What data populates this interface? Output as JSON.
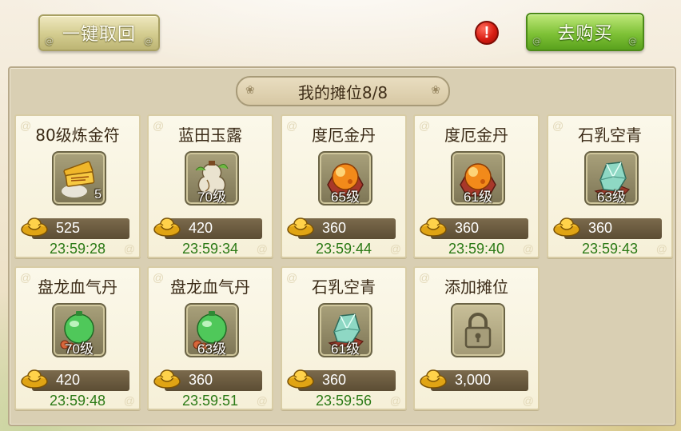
{
  "header": {
    "withdraw_all_label": "一键取回",
    "buy_label": "去购买",
    "alert_symbol": "!"
  },
  "panel": {
    "title": "我的摊位8/8"
  },
  "stalls": [
    {
      "name": "80级炼金符",
      "badge": "5",
      "price": "525",
      "timer": "23:59:28",
      "icon": "gold-talisman-icon"
    },
    {
      "name": "蓝田玉露",
      "badge": "70级",
      "price": "420",
      "timer": "23:59:34",
      "icon": "jade-gourd-icon"
    },
    {
      "name": "度厄金丹",
      "badge": "65级",
      "price": "360",
      "timer": "23:59:44",
      "icon": "golden-pill-icon"
    },
    {
      "name": "度厄金丹",
      "badge": "61级",
      "price": "360",
      "timer": "23:59:40",
      "icon": "golden-pill-icon"
    },
    {
      "name": "石乳空青",
      "badge": "63级",
      "price": "360",
      "timer": "23:59:43",
      "icon": "crystal-stone-icon"
    },
    {
      "name": "盘龙血气丹",
      "badge": "70级",
      "price": "420",
      "timer": "23:59:48",
      "icon": "green-elixir-icon"
    },
    {
      "name": "盘龙血气丹",
      "badge": "63级",
      "price": "360",
      "timer": "23:59:51",
      "icon": "green-elixir-icon"
    },
    {
      "name": "石乳空青",
      "badge": "61级",
      "price": "360",
      "timer": "23:59:56",
      "icon": "crystal-stone-icon"
    },
    {
      "name": "添加摊位",
      "badge": "",
      "price": "3,000",
      "timer": "",
      "icon": "lock-icon"
    }
  ],
  "colors": {
    "timer_green": "#2b7a16",
    "buy_button_green": "#7fc237",
    "alert_red": "#d81d12"
  }
}
